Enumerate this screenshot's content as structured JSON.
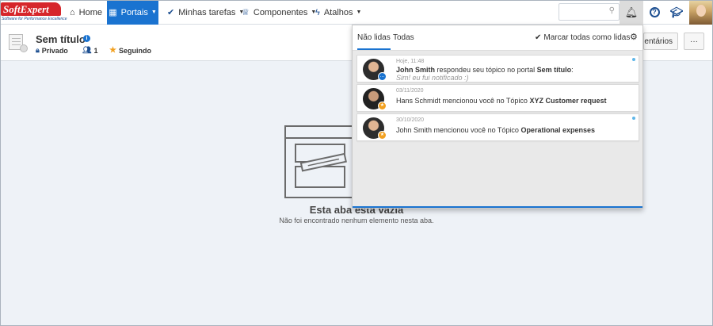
{
  "brand": {
    "name": "SoftExpert",
    "tagline": "Software for Performance Excellence"
  },
  "nav": [
    {
      "label": "Home",
      "icon": "home-icon",
      "glyph": "⌂",
      "active": false,
      "caret": false
    },
    {
      "label": "Portais",
      "icon": "grid-icon",
      "glyph": "▦",
      "active": true,
      "caret": true
    },
    {
      "label": "Minhas tarefas",
      "icon": "check-icon",
      "glyph": "✔",
      "active": false,
      "caret": true
    },
    {
      "label": "Componentes",
      "icon": "trophy-icon",
      "glyph": "♕",
      "active": false,
      "caret": true
    },
    {
      "label": "Atalhos",
      "icon": "bolt-icon",
      "glyph": "ϟ",
      "active": false,
      "caret": true
    }
  ],
  "search": {
    "placeholder": "",
    "value": ""
  },
  "page": {
    "title": "Sem título",
    "visibility": "Privado",
    "members": "1",
    "follow": "Seguindo",
    "comments_button": "mentários",
    "more_button": "···"
  },
  "empty_state": {
    "title": "Esta aba está vazia",
    "subtitle": "Não foi encontrado nenhum elemento nesta aba."
  },
  "notifications": {
    "tabs": [
      "Não lidas",
      "Todas"
    ],
    "active_tab": "Não lidas",
    "mark_all": "Marcar todas como lidas",
    "items": [
      {
        "time": "Hoje, 11:48",
        "pre": "John Smith",
        "mid": " respondeu seu tópico no portal ",
        "post": "Sem título",
        "end": ":",
        "quote": "Sim! eu fui notificado :)",
        "badge_color": "#1a73d0",
        "badge": "…"
      },
      {
        "time": "03/11/2020",
        "pre": "",
        "mid": "Hans Schmidt mencionou você no Tópico ",
        "post": "XYZ Customer request",
        "end": "",
        "quote": "",
        "badge_color": "#f2a01f",
        "badge": "★"
      },
      {
        "time": "30/10/2020",
        "pre": "",
        "mid": "John Smith mencionou você no Tópico ",
        "post": "Operational expenses",
        "end": "",
        "quote": "",
        "badge_color": "#f2a01f",
        "badge": "★"
      }
    ]
  },
  "colors": {
    "accent": "#1a73d0",
    "brand_red": "#d6262b",
    "unread_dot": "#5fb6e8",
    "star": "#f2a01f"
  }
}
